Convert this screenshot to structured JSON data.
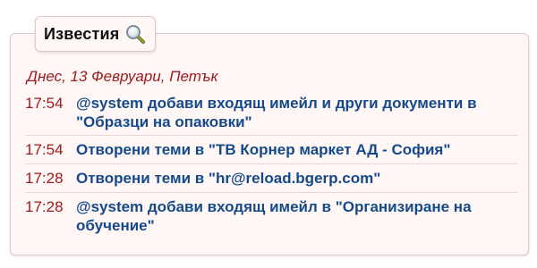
{
  "widget": {
    "title": "Известия",
    "icon": "search-icon",
    "date_heading": "Днес, 13 Февруари, Петък"
  },
  "items": [
    {
      "time": "17:54",
      "text": "@system добави входящ имейл и други документи в \"Образци на опаковки\""
    },
    {
      "time": "17:54",
      "text": "Отворени теми в \"ТВ Корнер маркет АД - София\""
    },
    {
      "time": "17:28",
      "text": "Отворени теми в \"hr@reload.bgerp.com\""
    },
    {
      "time": "17:28",
      "text": "@system добави входящ имейл в \"Организиране на обучение\""
    }
  ],
  "colors": {
    "panel_bg": "#fff6f6",
    "border": "#e3c8c8",
    "time_color": "#9b1a1a",
    "link_color": "#154a8a"
  }
}
